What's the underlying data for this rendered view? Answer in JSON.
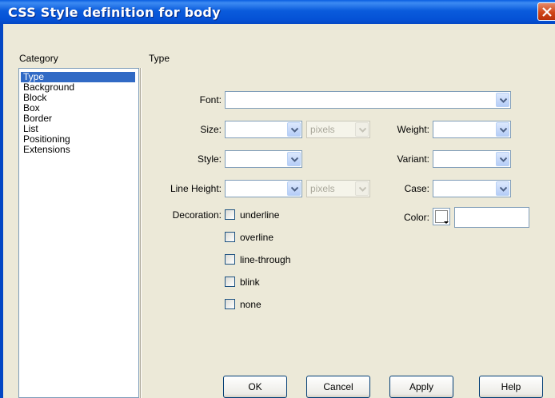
{
  "window": {
    "title": "CSS Style definition for body"
  },
  "category": {
    "heading": "Category",
    "items": [
      "Type",
      "Background",
      "Block",
      "Box",
      "Border",
      "List",
      "Positioning",
      "Extensions"
    ],
    "selected": "Type"
  },
  "panel": {
    "heading": "Type"
  },
  "fields": {
    "font": {
      "label": "Font:",
      "value": ""
    },
    "size": {
      "label": "Size:",
      "value": "",
      "unit": "pixels"
    },
    "weight": {
      "label": "Weight:",
      "value": ""
    },
    "style": {
      "label": "Style:",
      "value": ""
    },
    "variant": {
      "label": "Variant:",
      "value": ""
    },
    "line_height": {
      "label": "Line Height:",
      "value": "",
      "unit": "pixels"
    },
    "case": {
      "label": "Case:",
      "value": ""
    },
    "color": {
      "label": "Color:",
      "value": ""
    }
  },
  "decoration": {
    "label": "Decoration:",
    "options": [
      {
        "label": "underline",
        "checked": false
      },
      {
        "label": "overline",
        "checked": false
      },
      {
        "label": "line-through",
        "checked": false
      },
      {
        "label": "blink",
        "checked": false
      },
      {
        "label": "none",
        "checked": false
      }
    ]
  },
  "buttons": {
    "ok": "OK",
    "cancel": "Cancel",
    "apply": "Apply",
    "help": "Help"
  },
  "colors": {
    "titlebar": "#0A5BDC",
    "selection": "#316AC5",
    "dialog_bg": "#ECE9D8"
  }
}
